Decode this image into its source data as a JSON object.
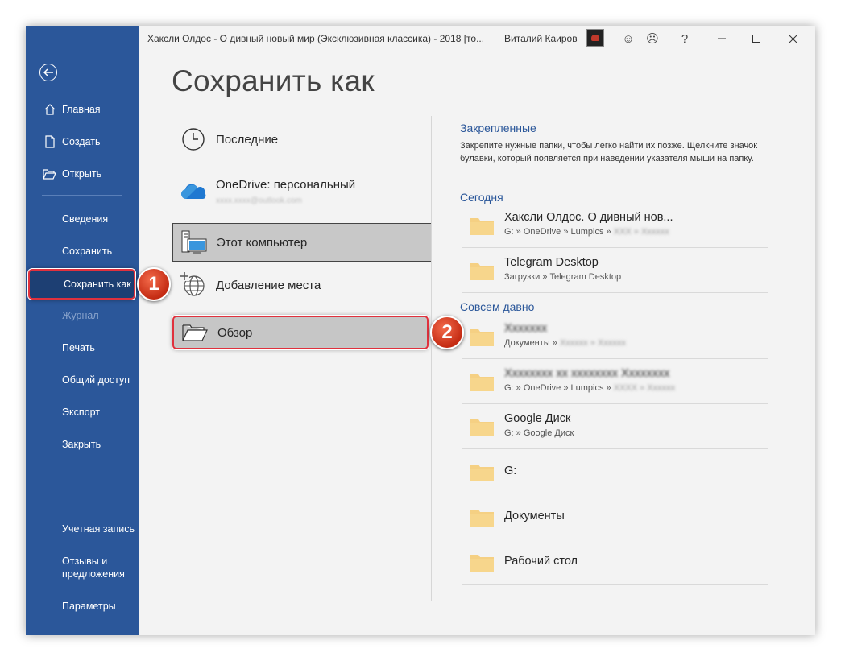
{
  "titlebar": {
    "doc_title": "Хаксли Олдос - О дивный новый мир (Эксклюзивная классика) - 2018 [то...",
    "user_name": "Виталий Каиров",
    "help": "?"
  },
  "sidebar": {
    "top_items": [
      {
        "label": "Главная",
        "icon": "home-icon"
      },
      {
        "label": "Создать",
        "icon": "new-document-icon"
      },
      {
        "label": "Открыть",
        "icon": "open-folder-icon"
      }
    ],
    "mid_items": [
      "Сведения",
      "Сохранить",
      "Сохранить как",
      "Журнал",
      "Печать",
      "Общий доступ",
      "Экспорт",
      "Закрыть"
    ],
    "bottom_items": [
      "Учетная запись",
      "Отзывы и предложения",
      "Параметры"
    ]
  },
  "main": {
    "title": "Сохранить как",
    "locations": [
      {
        "label": "Последние",
        "icon": "clock-icon"
      },
      {
        "label": "OneDrive: персональный",
        "sublabel": "xxxx.xxxx@outlook.com",
        "icon": "onedrive-icon"
      },
      {
        "label": "Этот компьютер",
        "icon": "computer-icon",
        "selected": true
      },
      {
        "label": "Добавление места",
        "icon": "add-place-icon"
      },
      {
        "label": "Обзор",
        "icon": "browse-folder-icon"
      }
    ]
  },
  "right": {
    "pinned_title": "Закрепленные",
    "pinned_hint": "Закрепите нужные папки, чтобы легко найти их позже. Щелкните значок булавки, который появляется при наведении указателя мыши на папку.",
    "today_title": "Сегодня",
    "today": [
      {
        "name": "Хаксли Олдос. О дивный нов...",
        "path": "G: » OneDrive » Lumpics »",
        "path_blurred": "ХХХ » Хххххх"
      },
      {
        "name": "Telegram Desktop",
        "path": "Загрузки » Telegram Desktop"
      }
    ],
    "older_title": "Совсем давно",
    "older": [
      {
        "name_blurred": "Ххххххх",
        "path": "Документы »",
        "path_blurred": "Хххххх » Хххххх"
      },
      {
        "name_blurred": "Хххххххх хх хххххххх Хххххххх",
        "path": "G: » OneDrive » Lumpics »",
        "path_blurred": "ХХХХ » Хххххх"
      },
      {
        "name": "Google Диск",
        "path": "G: » Google Диск"
      },
      {
        "name": "G:"
      },
      {
        "name": "Документы"
      },
      {
        "name": "Рабочий стол"
      }
    ]
  },
  "badges": {
    "one": "1",
    "two": "2"
  },
  "colors": {
    "sidebar": "#2b579a",
    "accent_text": "#2b579a",
    "highlight_border": "#e0313d",
    "folder": "#f5d083"
  }
}
